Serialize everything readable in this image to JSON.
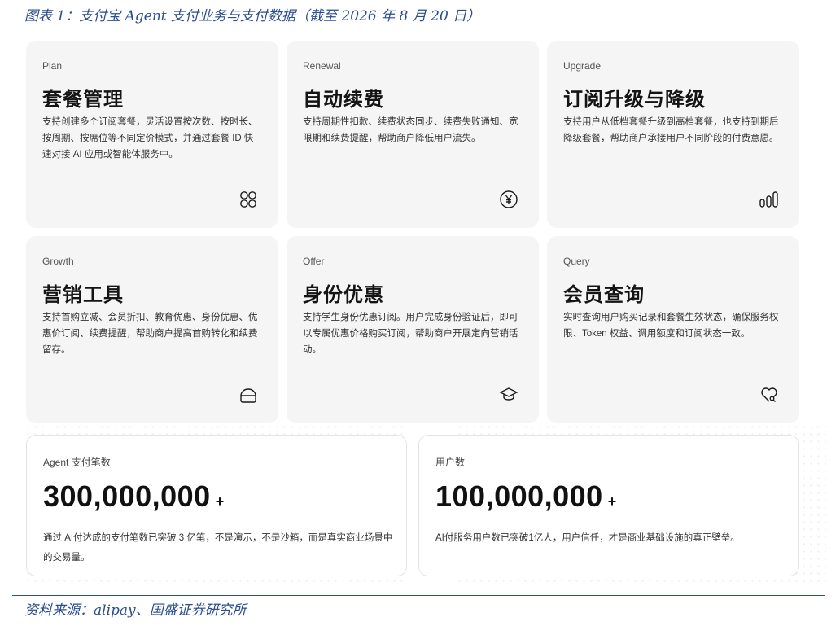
{
  "caption": "图表 1：支付宝 Agent 支付业务与支付数据（截至 2026 年 8 月 20 日）",
  "source": "资料来源：alipay、国盛证券研究所",
  "cards": [
    {
      "tag": "Plan",
      "title": "套餐管理",
      "desc": "支持创建多个订阅套餐，灵活设置按次数、按时长、按周期、按席位等不同定价模式，并通过套餐 ID 快速对接 AI 应用或智能体服务中。",
      "icon": "four-circles-icon"
    },
    {
      "tag": "Renewal",
      "title": "自动续费",
      "desc": "支持周期性扣款、续费状态同步、续费失败通知、宽限期和续费提醒，帮助商户降低用户流失。",
      "icon": "yuan-coin-icon"
    },
    {
      "tag": "Upgrade",
      "title": "订阅升级与降级",
      "desc": "支持用户从低档套餐升级到高档套餐，也支持到期后降级套餐，帮助商户承接用户不同阶段的付费意愿。",
      "icon": "bar-levels-icon"
    },
    {
      "tag": "Growth",
      "title": "营销工具",
      "desc": "支持首购立减、会员折扣、教育优惠、身份优惠、优惠价订阅、续费提醒，帮助商户提高首购转化和续费留存。",
      "icon": "half-circle-box-icon"
    },
    {
      "tag": "Offer",
      "title": "身份优惠",
      "desc": "支持学生身份优惠订阅。用户完成身份验证后，即可以专属优惠价格购买订阅，帮助商户开展定向营销活动。",
      "icon": "graduation-cap-icon"
    },
    {
      "tag": "Query",
      "title": "会员查询",
      "desc": "实时查询用户购买记录和套餐生效状态，确保服务权限、Token 权益、调用额度和订阅状态一致。",
      "icon": "heart-search-icon"
    }
  ],
  "stats": [
    {
      "label": "Agent 支付笔数",
      "value": "300,000,000",
      "plus": "+",
      "desc": "通过 AI付达成的支付笔数已突破 3 亿笔，不是演示，不是沙箱，而是真实商业场景中的交易量。"
    },
    {
      "label": "用户数",
      "value": "100,000,000",
      "plus": "+",
      "desc": "AI付服务用户数已突破1亿人，用户信任，才是商业基础设施的真正壁垒。"
    }
  ]
}
